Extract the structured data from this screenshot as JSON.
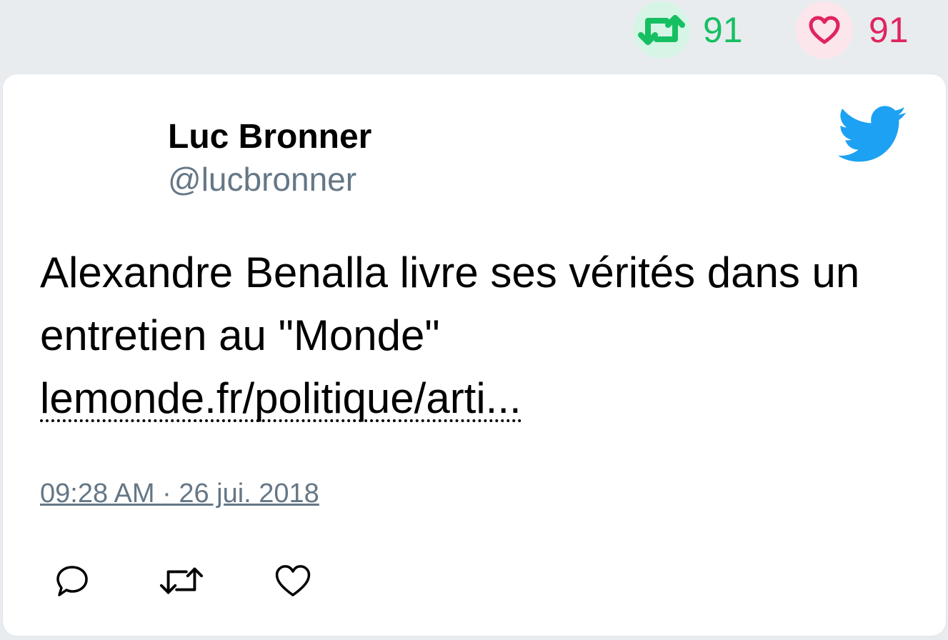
{
  "stats": {
    "retweets": "91",
    "likes": "91",
    "retweet_color": "#17bf63",
    "like_color": "#e0245e"
  },
  "tweet": {
    "author_name": "Luc Bronner",
    "author_handle": "@lucbronner",
    "text": "Alexandre Benalla livre ses vérités dans un entretien au \"Monde\"",
    "link_text": "lemonde.fr/politique/arti...",
    "timestamp": "09:28 AM · 26 jui. 2018"
  },
  "icons": {
    "logo": "twitter-bird-icon",
    "reply": "reply-icon",
    "retweet": "retweet-icon",
    "like": "heart-icon"
  },
  "colors": {
    "brand": "#1da1f2",
    "muted": "#657786"
  }
}
